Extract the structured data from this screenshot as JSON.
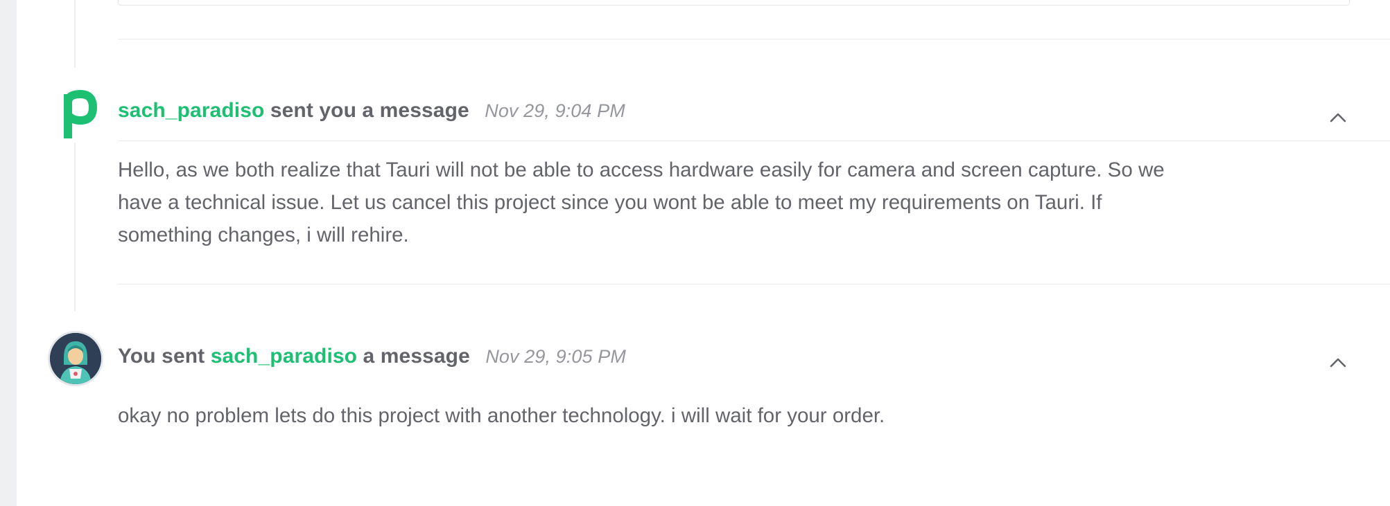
{
  "messages": [
    {
      "sender": "sach_paradiso",
      "header_suffix": "sent you a message",
      "timestamp": "Nov 29, 9:04 PM",
      "avatar_letter": "p",
      "avatar_color": "#1dbf73",
      "body": "Hello, as we both realize that Tauri will not be able to access hardware easily for camera and screen capture. So we have a technical issue. Let us cancel this project since you wont be able to meet my requirements on Tauri. If something changes, i will rehire."
    },
    {
      "header_prefix": "You sent",
      "recipient": "sach_paradiso",
      "header_suffix": "a message",
      "timestamp": "Nov 29, 9:05 PM",
      "body": "okay no problem lets do this project with another technology. i will wait for your order."
    }
  ],
  "colors": {
    "accent": "#1dbf73",
    "text": "#62646a",
    "muted": "#95979d",
    "divider": "#e9eaec",
    "background": "#eef0f2"
  },
  "icons": {
    "collapse": "chevron-up-icon"
  }
}
